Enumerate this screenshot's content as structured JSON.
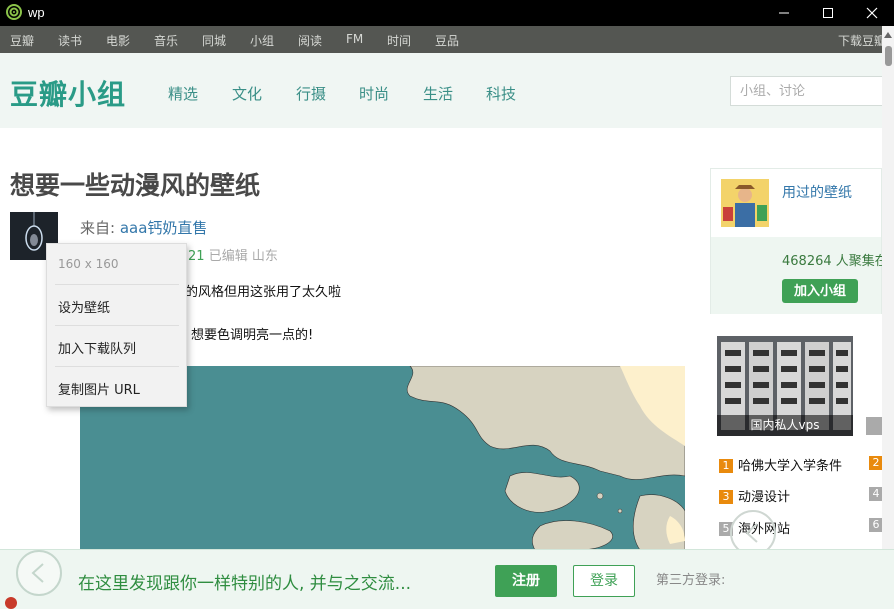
{
  "window": {
    "title": "wp",
    "logo_icon": "swirl-logo-icon",
    "controls": [
      "minimize",
      "maximize",
      "close"
    ]
  },
  "global_nav": {
    "items": [
      "豆瓣",
      "读书",
      "电影",
      "音乐",
      "同城",
      "小组",
      "阅读",
      "FM",
      "时间",
      "豆品"
    ],
    "right_link": "下载豆瓣"
  },
  "group_header": {
    "brand": "豆瓣小组",
    "categories": [
      "精选",
      "文化",
      "行摄",
      "时尚",
      "生活",
      "科技"
    ],
    "search_placeholder": "小组、讨论"
  },
  "post": {
    "title": "想要一些动漫风的壁纸",
    "from_label": "来自: ",
    "author": "aaa钙奶直售",
    "date_fragment": "21",
    "edit_label": "已编辑",
    "location": "山东",
    "line1": "的风格但用这张用了太久啦",
    "line2": "想要色调明亮一点的!"
  },
  "context_menu": {
    "size_label": "160 x 160",
    "items": [
      "设为壁纸",
      "加入下载队列",
      "复制图片 URL"
    ]
  },
  "sidebar": {
    "group_name": "用过的壁纸",
    "members_count": "468264",
    "members_label": "人聚集在",
    "join_button": "加入小组",
    "ad_label": "国内私人vps",
    "rank": [
      {
        "num": "1",
        "title": "哈佛大学入学条件",
        "highlight": true
      },
      {
        "num": "3",
        "title": "动漫设计",
        "highlight": true
      },
      {
        "num": "5",
        "title": "海外网站",
        "highlight": false
      }
    ],
    "rank_right": [
      {
        "num": "2",
        "highlight": true
      },
      {
        "num": "4",
        "highlight": false
      },
      {
        "num": "6",
        "highlight": false
      }
    ]
  },
  "bottom_banner": {
    "text": "在这里发现跟你一样特别的人, 并与之交流...",
    "register": "注册",
    "login": "登录",
    "third_party": "第三方登录:"
  },
  "colors": {
    "brand_green": "#2a9b87",
    "button_green": "#3fa156",
    "link_blue": "#3377aa",
    "rank_orange": "#e98a0d"
  }
}
